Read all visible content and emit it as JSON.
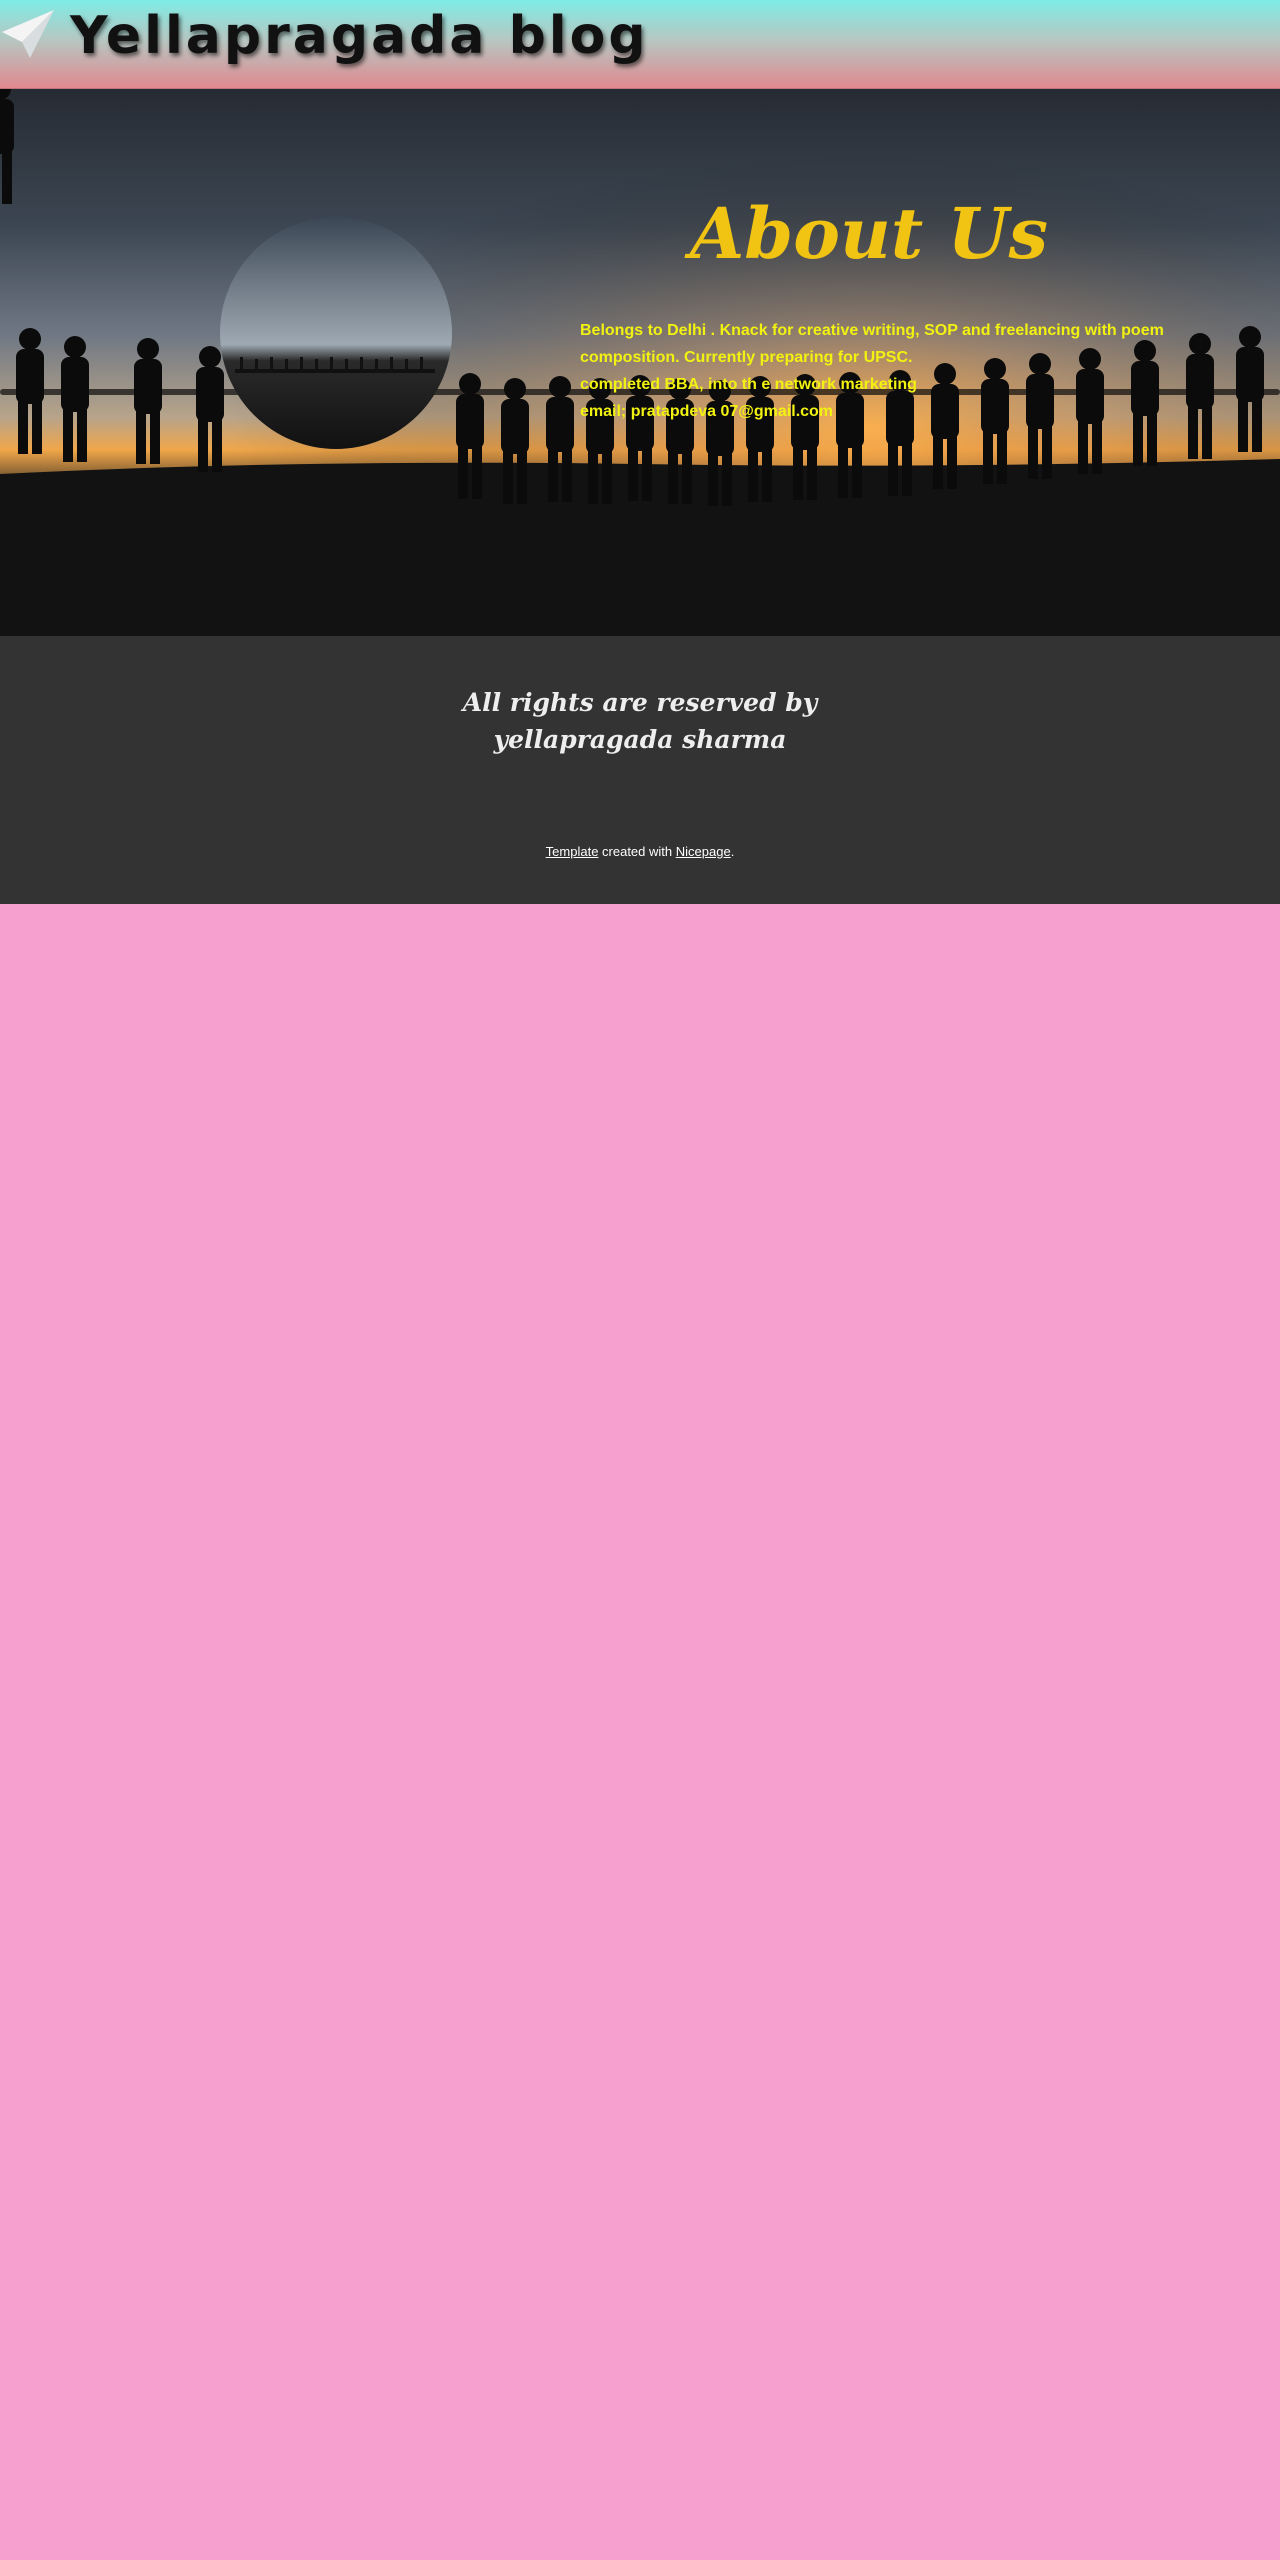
{
  "header": {
    "title": "Yellapragada blog",
    "logo_icon": "paper-plane-icon"
  },
  "about": {
    "title": "About Us",
    "lines": [
      "Belongs to Delhi . Knack for creative writing, SOP and freelancing with poem composition. Currently preparing for UPSC.",
      "completed BBA, into th e network marketing",
      "email; pratapdeva 07@gmail.com"
    ]
  },
  "footer": {
    "title_line1": "All rights are reserved by",
    "title_line2": "yellapragada sharma",
    "credit": {
      "link1": "Template",
      "middle": " created with ",
      "link2": "Nicepage",
      "end": "."
    }
  },
  "colors": {
    "header_top": "#7fece6",
    "header_bottom": "#e0898f",
    "about_title": "#f1c312",
    "about_text": "#f2f211",
    "footer_bg": "#333333",
    "page_bg": "#f6a0d0"
  }
}
